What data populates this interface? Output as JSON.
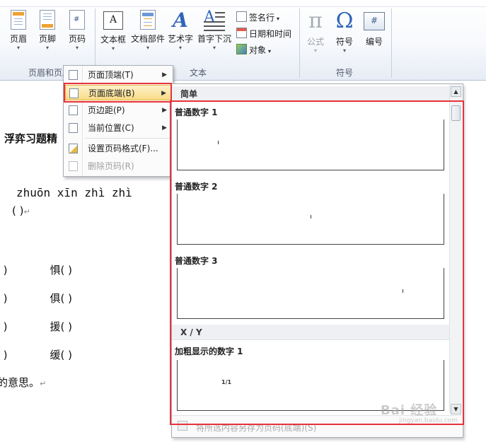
{
  "ribbon": {
    "buttons": {
      "header": "页眉",
      "footer": "页脚",
      "page_number": "页码",
      "text_box": "文本框",
      "quick_parts": "文档部件",
      "wordart": "艺术字",
      "drop_cap": "首字下沉",
      "equation": "公式",
      "symbol": "符号",
      "number": "编号"
    },
    "small_buttons": {
      "signature_line": "签名行",
      "date_time": "日期和时间",
      "object": "对象"
    },
    "groups": {
      "header_footer": "页眉和页脚",
      "text": "文本",
      "symbols": "符号"
    }
  },
  "document": {
    "title_fragment": "浮弈习题精",
    "pinyin": "zhuōn xīn zhì zhì",
    "paren_line": "(                    )",
    "rows": [
      {
        "left": "(          )",
        "char": "惧",
        "right": "(          )"
      },
      {
        "left": "(          )",
        "char": "俱",
        "right": "(          )"
      },
      {
        "left": "(          )",
        "char": "援",
        "right": "(          )"
      },
      {
        "left": "(          )",
        "char": "缓",
        "right": "(          )"
      }
    ],
    "meaning_tail": "的意思。",
    "para_mark": "↵"
  },
  "context_menu": {
    "items": [
      {
        "label": "页面顶端(T)",
        "submenu": true,
        "disabled": false,
        "highlighted": false
      },
      {
        "label": "页面底端(B)",
        "submenu": true,
        "disabled": false,
        "highlighted": true
      },
      {
        "label": "页边距(P)",
        "submenu": true,
        "disabled": false,
        "highlighted": false
      },
      {
        "label": "当前位置(C)",
        "submenu": true,
        "disabled": false,
        "highlighted": false
      },
      {
        "label": "设置页码格式(F)...",
        "submenu": false,
        "disabled": false,
        "highlighted": false
      },
      {
        "label": "删除页码(R)",
        "submenu": false,
        "disabled": true,
        "highlighted": false
      }
    ]
  },
  "gallery": {
    "section_simple": "简单",
    "section_xy": "X / Y",
    "items": [
      {
        "title": "普通数字 1",
        "marker": "1"
      },
      {
        "title": "普通数字 2",
        "marker": "1"
      },
      {
        "title": "普通数字 3",
        "marker": "1"
      },
      {
        "title": "加粗显示的数字 1",
        "marker": "1/1"
      }
    ],
    "footer_label": "将所选内容另存为页码(底端)(S)"
  },
  "watermark": {
    "text": "Bai 经验",
    "sub": "jingyan.baidu.com"
  },
  "colors": {
    "highlight_red": "#e8323c",
    "menu_highlight": "#f9dc87",
    "ribbon_bg": "#f7f9fc"
  }
}
